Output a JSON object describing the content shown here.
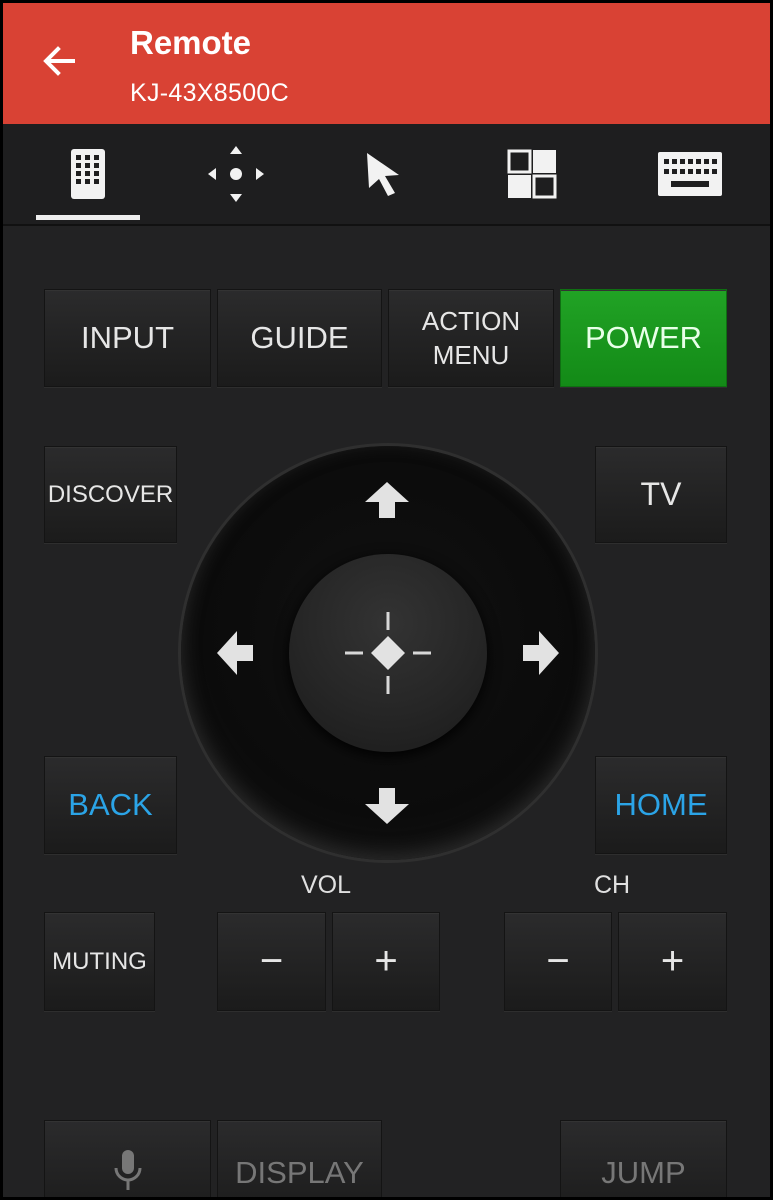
{
  "header": {
    "title": "Remote",
    "subtitle": "KJ-43X8500C"
  },
  "tabs": [
    {
      "icon": "remote-icon",
      "active": true
    },
    {
      "icon": "dpad-icon"
    },
    {
      "icon": "pointer-icon"
    },
    {
      "icon": "apps-grid-icon"
    },
    {
      "icon": "keyboard-icon"
    }
  ],
  "row1": {
    "input": "INPUT",
    "guide": "GUIDE",
    "action_menu_line1": "ACTION",
    "action_menu_line2": "MENU",
    "power": "POWER"
  },
  "side": {
    "discover": "DISCOVER",
    "tv": "TV",
    "back": "BACK",
    "home": "HOME"
  },
  "volume": {
    "label": "VOL",
    "minus": "−",
    "plus": "+"
  },
  "channel": {
    "label": "CH",
    "minus": "−",
    "plus": "+"
  },
  "muting": "MUTING",
  "bottom": {
    "display": "DISPLAY",
    "jump": "JUMP",
    "mic_icon": "microphone-icon"
  },
  "colors": {
    "appbar": "#d94234",
    "power": "#1a9a1e",
    "accent_text": "#2ba4e7"
  }
}
